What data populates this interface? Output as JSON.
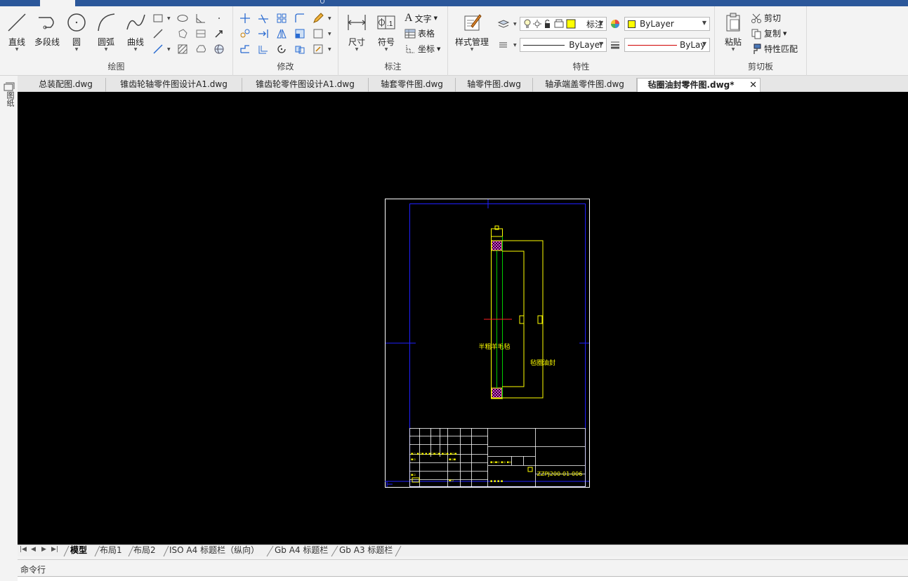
{
  "ribbon": {
    "draw_panel": {
      "title": "绘图",
      "line": "直线",
      "polyline": "多段线",
      "circle": "圆",
      "arc": "圆弧",
      "curve": "曲线"
    },
    "modify_panel": {
      "title": "修改"
    },
    "annotation_panel": {
      "title": "标注",
      "dimension": "尺寸",
      "symbol": "符号",
      "text": "文字",
      "table": "表格",
      "coordinate": "坐标"
    },
    "properties_panel": {
      "title": "特性",
      "style_manager": "样式管理",
      "layer_name": "标注",
      "color_value": "ByLayer",
      "linetype_value": "ByLayer",
      "lineweight_value": "ByLay",
      "layer_color": "#ffff00",
      "line_color": "#d00000"
    },
    "clipboard_panel": {
      "title": "剪切板",
      "paste": "粘贴",
      "cut": "剪切",
      "copy": "复制",
      "match_properties": "特性匹配"
    }
  },
  "leftbar": {
    "label": "图纸"
  },
  "doc_tabs": [
    {
      "label": "总装配图.dwg"
    },
    {
      "label": "锥齿轮轴零件图设计A1.dwg"
    },
    {
      "label": "锥齿轮零件图设计A1.dwg"
    },
    {
      "label": "轴套零件图.dwg"
    },
    {
      "label": "轴零件图.dwg"
    },
    {
      "label": "轴承端盖零件图.dwg"
    },
    {
      "label": "毡圈油封零件图.dwg*",
      "active": true
    }
  ],
  "drawing": {
    "title_block_material": "半粗羊毛毡",
    "part_name": "毡圈油封",
    "drawing_number": "ZZPJ200-01-006"
  },
  "layout_tabs": [
    {
      "label": "模型",
      "active": true
    },
    {
      "label": "布局1"
    },
    {
      "label": "布局2"
    },
    {
      "label": "ISO A4 标题栏（纵向）"
    },
    {
      "label": "Gb A4 标题栏"
    },
    {
      "label": "Gb A3 标题栏"
    }
  ],
  "command_line": {
    "label": "命令行"
  }
}
